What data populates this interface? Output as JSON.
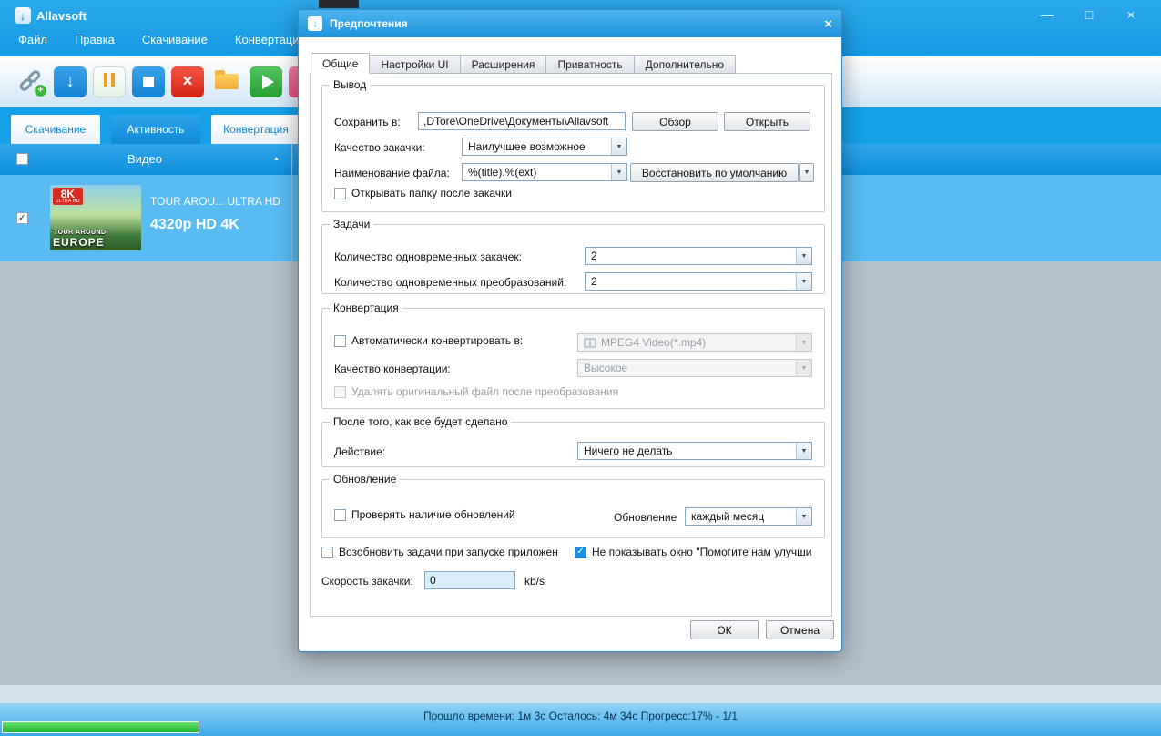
{
  "icons": {
    "minimize": "—",
    "maximize": "□",
    "close": "×",
    "dropdown": "▼",
    "check": "✓",
    "sort": "▲",
    "plus": "+",
    "download_arrow": "↓"
  },
  "main": {
    "title": "Allavsoft",
    "menu": [
      "Файл",
      "Правка",
      "Скачивание",
      "Конвертация"
    ],
    "tabs": [
      "Скачивание",
      "Активность",
      "Конвертация"
    ],
    "table": {
      "column_video": "Видео",
      "row": {
        "title": "TOUR AROU... ULTRA HD",
        "resolution": "4320p HD 4K",
        "thumb_badge": "8K",
        "thumb_badge_sub": "ULTRA HD",
        "thumb_line1": "TOUR AROUND",
        "thumb_line2": "EUROPE"
      }
    },
    "status": "Прошло времени: 1м  3с Осталось: 4м 34с Прогресс:17% - 1/1"
  },
  "dialog": {
    "title": "Предпочтения",
    "tabs": [
      "Общие",
      "Настройки UI",
      "Расширения",
      "Приватность",
      "Дополнительно"
    ],
    "output": {
      "legend": "Вывод",
      "save_label": "Сохранить в:",
      "save_value": ",DTore\\OneDrive\\Документы\\Allavsoft",
      "browse_btn": "Обзор",
      "open_btn": "Открыть",
      "quality_label": "Качество закачки:",
      "quality_value": "Наилучшее возможное",
      "naming_label": "Наименование файла:",
      "naming_value": "%(title).%(ext)",
      "restore_btn": "Восстановить по умолчанию",
      "open_folder_label": "Открывать папку после закачки"
    },
    "tasks": {
      "legend": "Задачи",
      "downloads_label": "Количество одновременных закачек:",
      "downloads_value": "2",
      "conversions_label": "Количество одновременных преобразований:",
      "conversions_value": "2"
    },
    "conversion": {
      "legend": "Конвертация",
      "auto_label": "Автоматически конвертировать в:",
      "auto_value": "MPEG4 Video(*.mp4)",
      "quality_label": "Качество конвертации:",
      "quality_value": "Высокое",
      "delete_label": "Удалять оригинальный файл после преобразования"
    },
    "after_done": {
      "legend": "После того, как все будет сделано",
      "action_label": "Действие:",
      "action_value": "Ничего не делать"
    },
    "update": {
      "legend": "Обновление",
      "check_label": "Проверять наличие обновлений",
      "period_label": "Обновление",
      "period_value": "каждый месяц"
    },
    "misc": {
      "resume_label": "Возобновить задачи при запуске приложен",
      "hide_label": "Не показывать окно \"Помогите нам улучши",
      "speed_label": "Скорость закачки:",
      "speed_value": "0",
      "speed_unit": "kb/s"
    },
    "ok_btn": "ОК",
    "cancel_btn": "Отмена"
  }
}
